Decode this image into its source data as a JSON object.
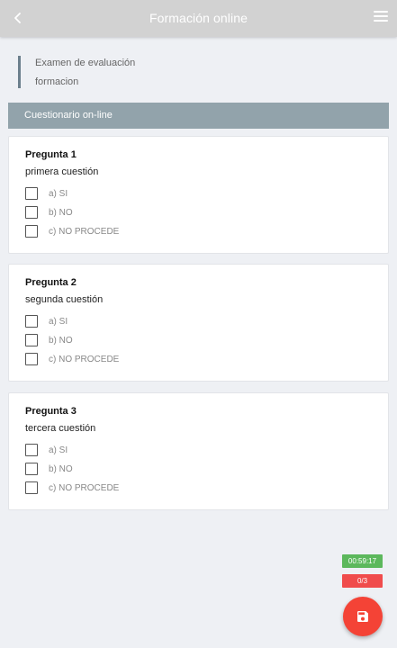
{
  "header": {
    "title": "Formación online",
    "back_icon": "chevron-left-icon",
    "menu_icon": "hamburger-menu-icon"
  },
  "info": {
    "line1": "Examen de evaluación",
    "line2": "formacion"
  },
  "section": {
    "title": "Cuestionario on-line"
  },
  "questions": [
    {
      "title": "Pregunta 1",
      "text": "primera cuestión",
      "options": [
        "a) SI",
        "b) NO",
        "c) NO PROCEDE"
      ]
    },
    {
      "title": "Pregunta 2",
      "text": "segunda cuestión",
      "options": [
        "a) SI",
        "b) NO",
        "c) NO PROCEDE"
      ]
    },
    {
      "title": "Pregunta 3",
      "text": "tercera cuestión",
      "options": [
        "a) SI",
        "b) NO",
        "c) NO PROCEDE"
      ]
    }
  ],
  "status": {
    "timer": "00:59:17",
    "score": "0/3",
    "timer_color": "#5cb85c",
    "score_color": "#f04c4c"
  },
  "fab": {
    "icon": "save-icon",
    "color": "#f44336"
  }
}
